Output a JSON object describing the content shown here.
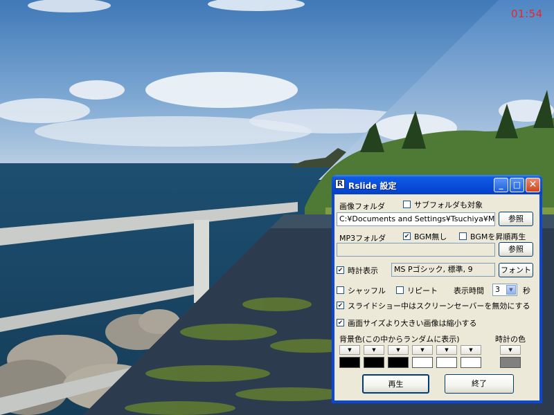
{
  "overlay": {
    "clock": "01:54"
  },
  "window": {
    "title": "Rslide  設定",
    "app_icon": "R",
    "controls": {
      "minimize": "_",
      "maximize": "□",
      "close": "✕"
    }
  },
  "form": {
    "image_folder": {
      "label": "画像フォルダ",
      "subfolder_label": "サブフォルダも対象",
      "subfolder_checked": false,
      "path_value": "C:¥Documents and Settings¥Tsuchiya¥My D",
      "browse_label": "参照"
    },
    "mp3_folder": {
      "label": "MP3フォルダ",
      "no_bgm_label": "BGM無し",
      "no_bgm_checked": true,
      "ascending_label": "BGMを昇順再生",
      "ascending_checked": false,
      "path_value": "",
      "browse_label": "参照"
    },
    "clock": {
      "show_label": "時計表示",
      "show_checked": true,
      "font_value": "MS Pゴシック, 標準, 9",
      "font_button": "フォント"
    },
    "playback": {
      "shuffle_label": "シャッフル",
      "shuffle_checked": false,
      "repeat_label": "リピート",
      "repeat_checked": false,
      "time_label": "表示時間",
      "time_value": "3",
      "seconds_label": "秒"
    },
    "disable_screensaver": {
      "label": "スライドショー中はスクリーンセーバーを無効にする",
      "checked": true
    },
    "shrink_large": {
      "label": "画面サイズより大きい画像は縮小する",
      "checked": true
    },
    "colors": {
      "bg_label": "背景色(この中からランダムに表示)",
      "clock_label": "時計の色",
      "bg_swatches": [
        "#000000",
        "#000000",
        "#000000",
        "#ffffff",
        "#ffffff",
        "#ffffff"
      ],
      "clock_swatch": "#808080",
      "dropdown_glyph": "▼"
    },
    "actions": {
      "play": "再生",
      "exit": "終了"
    }
  }
}
